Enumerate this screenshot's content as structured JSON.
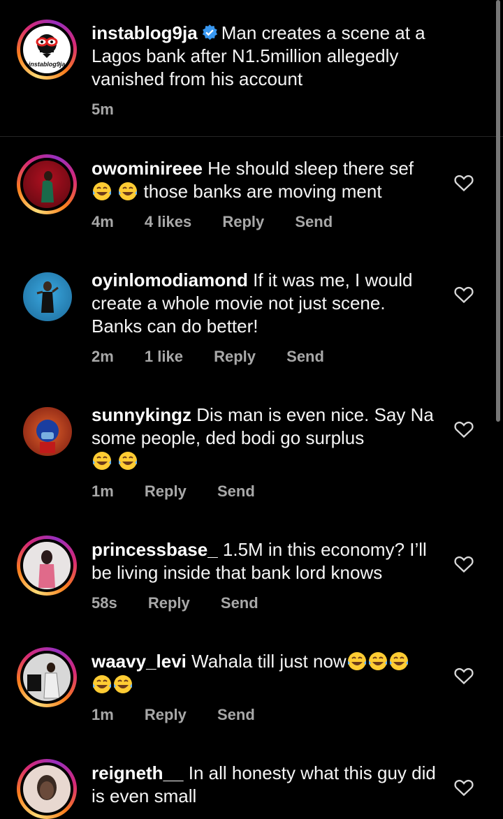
{
  "post": {
    "username": "instablog9ja",
    "caption": "Man creates a scene at a Lagos bank after N1.5million allegedly vanished from his account",
    "time": "5m",
    "avatar_text": "instablog9ja"
  },
  "comments": [
    {
      "username": "owominireee",
      "text": "He should sleep there sef",
      "emoji_mid": 2,
      "text2": "those banks are moving ment",
      "time": "4m",
      "likes": "4 likes",
      "reply": "Reply",
      "send": "Send"
    },
    {
      "username": "oyinlomodiamond",
      "text": "If it was me, I would create a whole movie not just scene. Banks can do better!",
      "time": "2m",
      "likes": "1 like",
      "reply": "Reply",
      "send": "Send"
    },
    {
      "username": "sunnykingz",
      "text": "Dis man is even nice. Say Na some people, ded bodi go surplus",
      "time": "1m",
      "reply": "Reply",
      "send": "Send"
    },
    {
      "username": "princessbase_",
      "text": "1.5M in this economy? I’ll be living inside that bank lord knows",
      "time": "58s",
      "reply": "Reply",
      "send": "Send"
    },
    {
      "username": "waavy_levi",
      "text": "Wahala till just now",
      "time": "1m",
      "reply": "Reply",
      "send": "Send"
    },
    {
      "username": "reigneth__",
      "text": "In all honesty what this guy did is even small"
    }
  ],
  "icons": {
    "like": "heart-outline-icon",
    "verified": "verified-badge-icon",
    "emoji": "face-with-tears-of-joy-emoji"
  },
  "colors": {
    "background": "#000000",
    "text": "#f5f5f5",
    "meta": "#a8a8a8",
    "verified": "#3897f0"
  }
}
